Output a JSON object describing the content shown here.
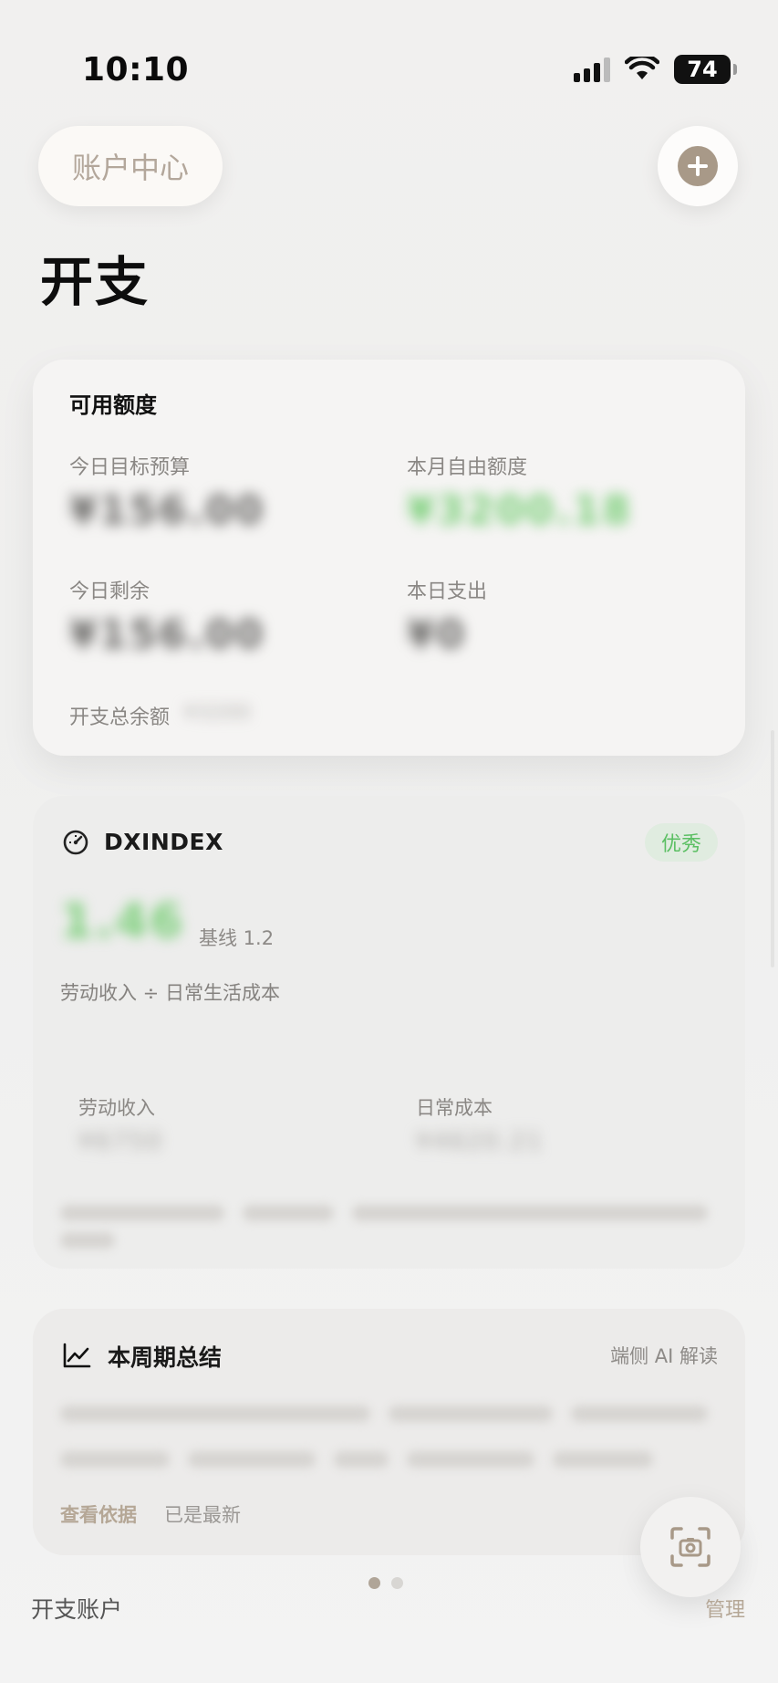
{
  "status_bar": {
    "time": "10:10",
    "battery": "74"
  },
  "header": {
    "account_center_label": "账户中心",
    "title": "开支"
  },
  "quota_card": {
    "title": "可用额度",
    "today_budget_label": "今日目标预算",
    "month_free_label": "本月自由额度",
    "today_remaining_label": "今日剩余",
    "today_spent_label": "本日支出",
    "total_balance_label": "开支总余额"
  },
  "dx_card": {
    "title": "DXINDEX",
    "badge": "优秀",
    "baseline": "基线 1.2",
    "formula": "劳动收入 ÷ 日常生活成本",
    "labor_income_label": "劳动收入",
    "daily_cost_label": "日常成本"
  },
  "period_card": {
    "title": "本周期总结",
    "ai_label": "端侧 AI 解读",
    "view_basis_link": "查看依据",
    "latest_status": "已是最新"
  },
  "footer": {
    "left_label": "开支账户",
    "manage_label": "管理"
  },
  "colors": {
    "accent": "#A89988",
    "positive": "#5BBF63",
    "background": "#F0EFEE"
  },
  "icons": [
    "signal-icon",
    "wifi-icon",
    "battery-icon",
    "plus-icon",
    "gauge-icon",
    "trend-chart-icon",
    "camera-scan-icon"
  ]
}
